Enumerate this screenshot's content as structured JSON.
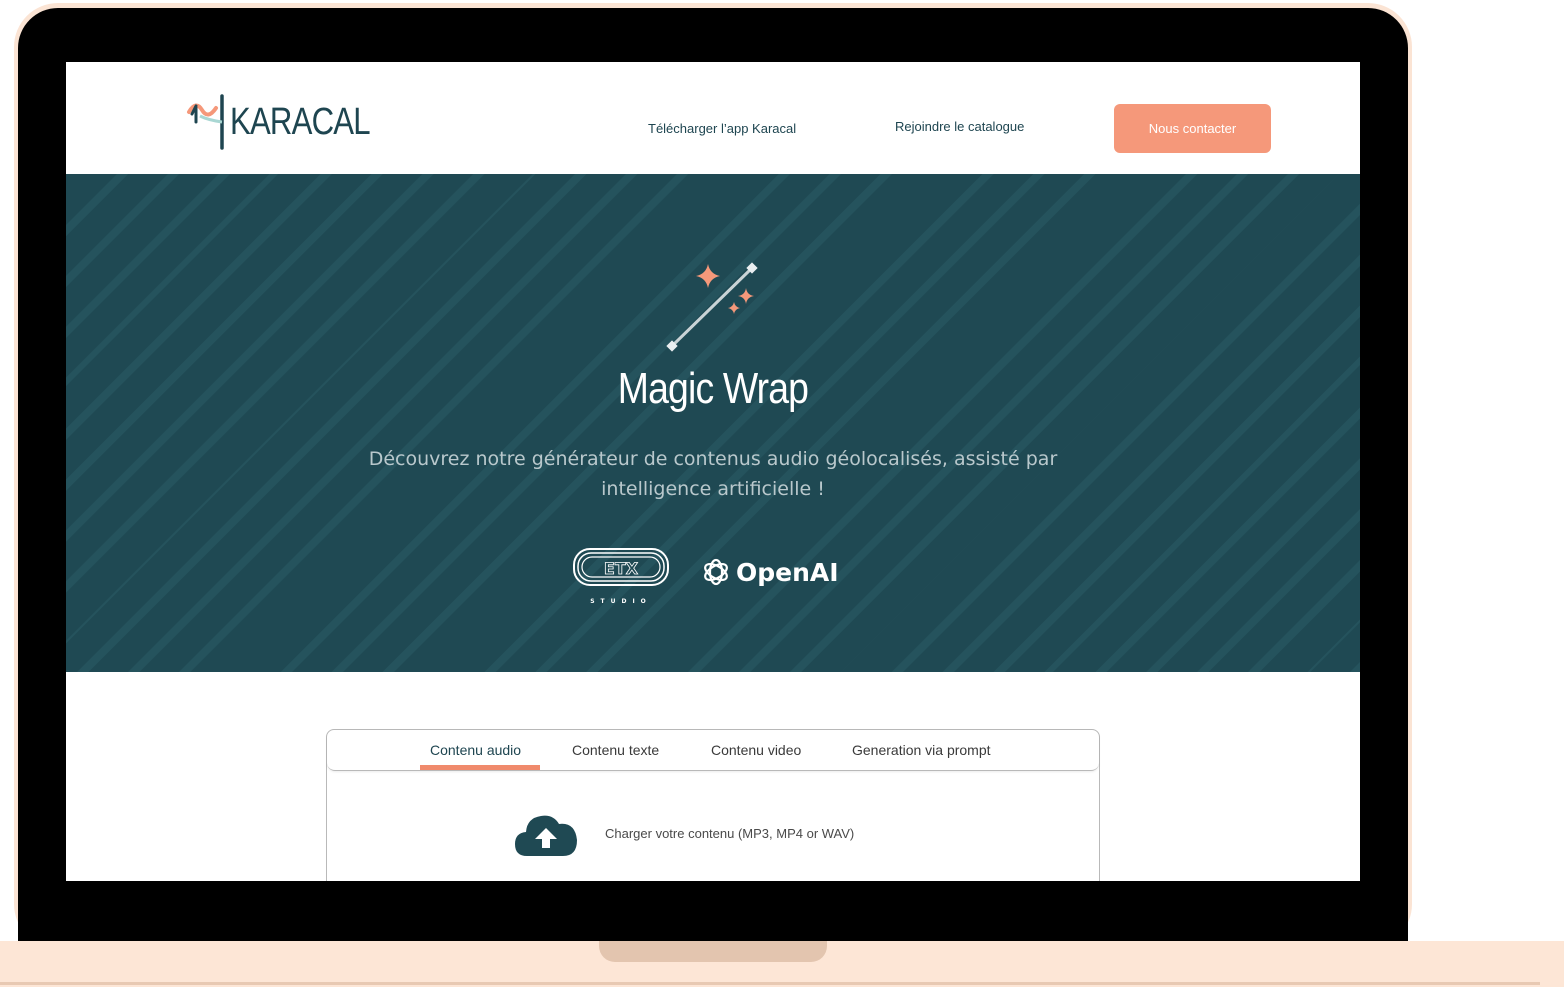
{
  "header": {
    "logo_text": "KARACAL",
    "nav": {
      "download_label": "Télécharger l’app Karacal",
      "catalog_label": "Rejoindre le catalogue"
    },
    "contact_label": "Nous contacter"
  },
  "hero": {
    "title": "Magic Wrap",
    "subtitle": "Découvrez notre générateur de contenus audio géolocalisés, assisté par intelligence artificielle !",
    "partners": {
      "etx_logo": "ETX",
      "etx_caption": "STUDIO",
      "openai_label": "OpenAI"
    }
  },
  "tabs": {
    "items": [
      "Contenu audio",
      "Contenu texte",
      "Contenu video",
      "Generation via prompt"
    ],
    "active": "Contenu audio"
  },
  "upload": {
    "label": "Charger votre contenu (MP3, MP4 or WAV)",
    "icon": "cloud-upload-icon"
  },
  "colors": {
    "accent": "#f5987a",
    "hero_bg": "#1f4953",
    "laptop_frame": "#fbe4d4",
    "brand_dark": "#1e4550"
  }
}
